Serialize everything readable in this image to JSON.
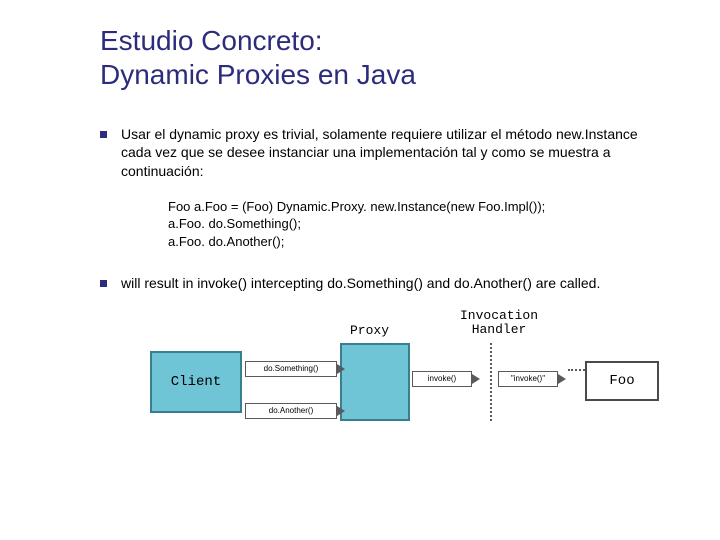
{
  "title_line1": "Estudio Concreto:",
  "title_line2": "Dynamic Proxies en Java",
  "bullet1": "Usar el dynamic proxy es trivial, solamente requiere utilizar el método new.Instance cada vez que se desee instanciar una implementación tal y como se muestra a continuación:",
  "code": {
    "l1": "Foo a.Foo = (Foo) Dynamic.Proxy. new.Instance(new Foo.Impl());",
    "l2": "a.Foo. do.Something();",
    "l3": "a.Foo. do.Another();"
  },
  "bullet2": "will result in invoke() intercepting do.Something() and do.Another() are called.",
  "diagram": {
    "client": "Client",
    "proxy_label": "Proxy",
    "handler_label_l1": "Invocation",
    "handler_label_l2": "Handler",
    "foo": "Foo",
    "arrow_do1": "do.Something()",
    "arrow_do2": "do.Another()",
    "arrow_invoke1": "invoke()",
    "arrow_invoke2": "\"invoke()\""
  }
}
